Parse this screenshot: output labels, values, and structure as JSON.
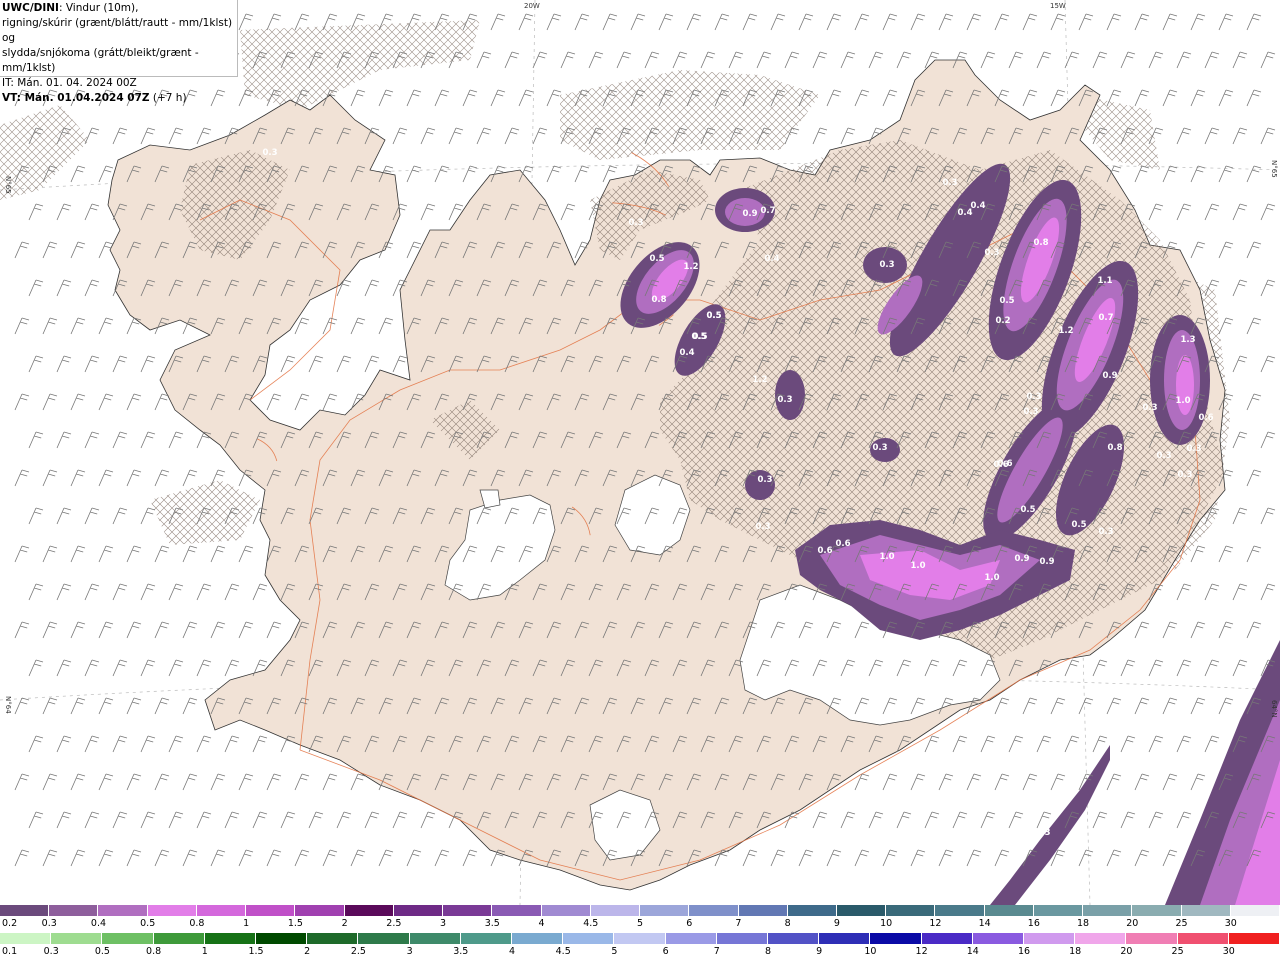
{
  "header": {
    "model": "UWC/DINI",
    "line1": ": Vindur (10m),",
    "line2": "rigning/skúrir (grænt/blátt/rautt - mm/1klst) og",
    "line3": "slydda/snjókoma (grátt/bleikt/grænt - mm/1klst)",
    "issue_time": "IT: Mán. 01. 04. 2024 00Z",
    "valid_time_label": "VT: Mán. 01.04.2024 07Z",
    "valid_offset": "(+7 h)"
  },
  "coords": {
    "lon_20w": "20W",
    "lon_15w": "15W",
    "lat_left_top": "N°65",
    "lat_right_top": "N°65",
    "lat_left_bottom": "N°64",
    "lat_right_bottom": "64°N"
  },
  "precip_labels": [
    {
      "text": "0.3"
    },
    {
      "text": "0.4"
    },
    {
      "text": "0.4"
    },
    {
      "text": "0.9"
    },
    {
      "text": "0.7"
    },
    {
      "text": "0.3"
    },
    {
      "text": "0.5"
    },
    {
      "text": "1.2"
    },
    {
      "text": "0.8"
    },
    {
      "text": "0.4"
    },
    {
      "text": "0.5"
    },
    {
      "text": "0.5"
    },
    {
      "text": "0.4"
    },
    {
      "text": "0.3"
    },
    {
      "text": "0.3"
    },
    {
      "text": "0.8"
    },
    {
      "text": "0.5"
    },
    {
      "text": "0.2"
    },
    {
      "text": "1.1"
    },
    {
      "text": "1.2"
    },
    {
      "text": "0.7"
    },
    {
      "text": "0.9"
    },
    {
      "text": "1.3"
    },
    {
      "text": "0.3"
    },
    {
      "text": "1.0"
    },
    {
      "text": "0.6"
    },
    {
      "text": "0.3"
    },
    {
      "text": "0.3"
    },
    {
      "text": "0.3"
    },
    {
      "text": "0.3"
    },
    {
      "text": "0.6"
    },
    {
      "text": "0.8"
    },
    {
      "text": "0.3"
    },
    {
      "text": "0.3"
    },
    {
      "text": "0.3"
    },
    {
      "text": "0.5"
    },
    {
      "text": "0.5"
    },
    {
      "text": "0.3"
    },
    {
      "text": "0.6"
    },
    {
      "text": "0.6"
    },
    {
      "text": "1.0"
    },
    {
      "text": "1.0"
    },
    {
      "text": "1.0"
    },
    {
      "text": "0.9"
    },
    {
      "text": "0.9"
    },
    {
      "text": "0.3"
    },
    {
      "text": "0.6"
    },
    {
      "text": "0.5"
    },
    {
      "text": "0.5"
    },
    {
      "text": "0.3"
    },
    {
      "text": "0.3"
    },
    {
      "text": "1.2"
    },
    {
      "text": "0.3"
    }
  ],
  "snow_scale": {
    "labels": [
      "0.2",
      "0.3",
      "0.4",
      "0.5",
      "0.8",
      "1",
      "1.5",
      "2",
      "2.5",
      "3",
      "3.5",
      "4",
      "4.5",
      "5",
      "6",
      "7",
      "8",
      "9",
      "10",
      "12",
      "14",
      "16",
      "18",
      "20",
      "25",
      "30"
    ],
    "colors": [
      "#6b4a7c",
      "#8e5e9c",
      "#b06ec0",
      "#e27ee8",
      "#d468dc",
      "#c050c8",
      "#a040b0",
      "#5a0a5a",
      "#6e2a86",
      "#7a3a96",
      "#8a5ab4",
      "#a08ad2",
      "#bcb6ea",
      "#9ca6da",
      "#7f90ca",
      "#6278b4",
      "#3e6a8a",
      "#2a5a6a",
      "#3a6a7a",
      "#4a7a8a",
      "#5a8a90",
      "#6a98a0",
      "#7aa0a8",
      "#8aacb0",
      "#a0b8c0",
      "#eef0f4"
    ]
  },
  "rain_scale": {
    "labels": [
      "0.1",
      "0.3",
      "0.5",
      "0.8",
      "1",
      "1.5",
      "2",
      "2.5",
      "3",
      "3.5",
      "4",
      "4.5",
      "5",
      "6",
      "7",
      "8",
      "9",
      "10",
      "12",
      "14",
      "16",
      "18",
      "20",
      "25",
      "30"
    ],
    "colors": [
      "#ccf5c4",
      "#9edc90",
      "#6ec064",
      "#3e9a3a",
      "#167216",
      "#004a00",
      "#1e6a2a",
      "#2e7a4a",
      "#3e8a6a",
      "#4e9a8a",
      "#7aaad0",
      "#9ab8e8",
      "#c2c8f2",
      "#9a9ae6",
      "#7676d6",
      "#5252c6",
      "#2e2eb6",
      "#0a0aa6",
      "#4a2ac6",
      "#8a5ae0",
      "#d09aee",
      "#f0a6ea",
      "#f07eb4",
      "#f05070",
      "#f02020"
    ]
  },
  "colors": {
    "land": "#f1e2d6",
    "road": "#e2703e",
    "glacier": "#ffffff",
    "ocean": "#ffffff",
    "barb": "#777777"
  }
}
